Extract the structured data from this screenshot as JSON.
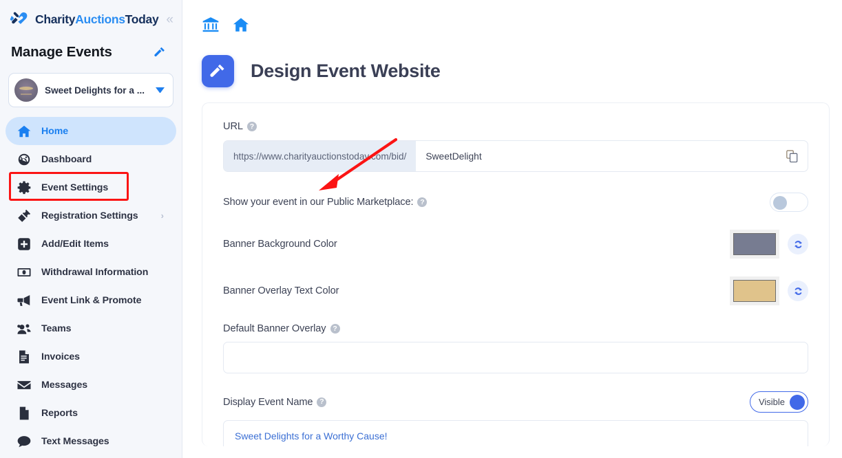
{
  "brand": {
    "charity": "Charity",
    "auctions": "Auctions",
    "today": "Today",
    "logo_icon": "heart-gavel-logo",
    "collapse_icon": "chevron-double-left-icon"
  },
  "sidebar": {
    "section_title": "Manage Events",
    "section_icon": "gavel-icon",
    "event_selector": {
      "name": "Sweet Delights for a ...",
      "avatar_icon": "event-avatar",
      "caret_icon": "caret-down-icon"
    },
    "items": [
      {
        "label": "Home",
        "icon": "home-icon",
        "active": true,
        "chevron": false
      },
      {
        "label": "Dashboard",
        "icon": "dashboard-gauge-icon",
        "active": false,
        "chevron": false
      },
      {
        "label": "Event Settings",
        "icon": "gear-icon",
        "active": false,
        "chevron": false,
        "highlighted": true
      },
      {
        "label": "Registration Settings",
        "icon": "ticket-icon",
        "active": false,
        "chevron": true
      },
      {
        "label": "Add/Edit Items",
        "icon": "plus-square-icon",
        "active": false,
        "chevron": false
      },
      {
        "label": "Withdrawal Information",
        "icon": "money-bill-icon",
        "active": false,
        "chevron": false
      },
      {
        "label": "Event Link & Promote",
        "icon": "megaphone-icon",
        "active": false,
        "chevron": false
      },
      {
        "label": "Teams",
        "icon": "users-icon",
        "active": false,
        "chevron": false
      },
      {
        "label": "Invoices",
        "icon": "invoice-document-icon",
        "active": false,
        "chevron": false
      },
      {
        "label": "Messages",
        "icon": "envelope-icon",
        "active": false,
        "chevron": false
      },
      {
        "label": "Reports",
        "icon": "file-icon",
        "active": false,
        "chevron": false
      },
      {
        "label": "Text Messages",
        "icon": "chat-bubble-icon",
        "active": false,
        "chevron": false
      }
    ]
  },
  "topbar": {
    "icons": [
      {
        "name": "bank-icon"
      },
      {
        "name": "home-icon"
      }
    ]
  },
  "page": {
    "title": "Design Event Website",
    "badge_icon": "gavel-icon"
  },
  "form": {
    "url": {
      "label": "URL",
      "help_icon": "help-circle-icon",
      "prefix": "https://www.charityauctionstoday.com/bid/",
      "value": "SweetDelight",
      "placeholder": "",
      "copy_icon": "copy-icon"
    },
    "marketplace": {
      "label": "Show your event in our Public Marketplace:",
      "help_icon": "help-circle-icon",
      "toggle_state": "off"
    },
    "banner_background": {
      "label": "Banner Background Color",
      "color": "#777c91",
      "refresh_icon": "refresh-icon"
    },
    "banner_overlay_text": {
      "label": "Banner Overlay Text Color",
      "color": "#e0c38b",
      "refresh_icon": "refresh-icon"
    },
    "default_banner_overlay": {
      "label": "Default Banner Overlay",
      "help_icon": "help-circle-icon",
      "value": "",
      "placeholder": ""
    },
    "display_event_name": {
      "label": "Display Event Name",
      "help_icon": "help-circle-icon",
      "toggle_label": "Visible",
      "toggle_state": "on",
      "value": "Sweet Delights for a Worthy Cause!",
      "placeholder": ""
    }
  },
  "annotations": {
    "highlight_target": "Event Settings",
    "arrow_color": "#fb1414",
    "box_color": "#fb1414"
  },
  "colors": {
    "accent_blue": "#4169e8",
    "link_blue": "#1a7ff0",
    "sidebar_bg": "#f5f7fb",
    "active_pill": "#cfe4fd"
  }
}
